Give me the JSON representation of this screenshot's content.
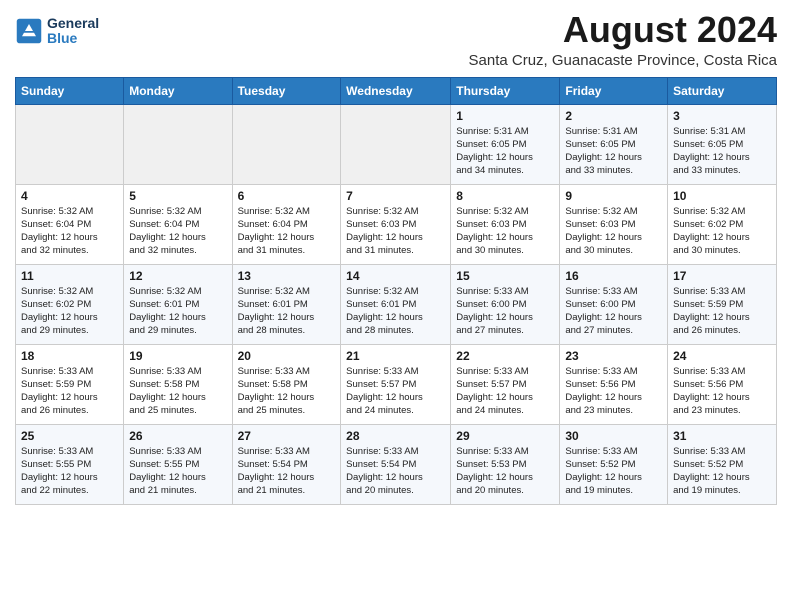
{
  "app": {
    "logo_line1": "General",
    "logo_line2": "Blue"
  },
  "header": {
    "title": "August 2024",
    "subtitle": "Santa Cruz, Guanacaste Province, Costa Rica"
  },
  "weekdays": [
    "Sunday",
    "Monday",
    "Tuesday",
    "Wednesday",
    "Thursday",
    "Friday",
    "Saturday"
  ],
  "weeks": [
    [
      {
        "day": "",
        "info": ""
      },
      {
        "day": "",
        "info": ""
      },
      {
        "day": "",
        "info": ""
      },
      {
        "day": "",
        "info": ""
      },
      {
        "day": "1",
        "info": "Sunrise: 5:31 AM\nSunset: 6:05 PM\nDaylight: 12 hours\nand 34 minutes."
      },
      {
        "day": "2",
        "info": "Sunrise: 5:31 AM\nSunset: 6:05 PM\nDaylight: 12 hours\nand 33 minutes."
      },
      {
        "day": "3",
        "info": "Sunrise: 5:31 AM\nSunset: 6:05 PM\nDaylight: 12 hours\nand 33 minutes."
      }
    ],
    [
      {
        "day": "4",
        "info": "Sunrise: 5:32 AM\nSunset: 6:04 PM\nDaylight: 12 hours\nand 32 minutes."
      },
      {
        "day": "5",
        "info": "Sunrise: 5:32 AM\nSunset: 6:04 PM\nDaylight: 12 hours\nand 32 minutes."
      },
      {
        "day": "6",
        "info": "Sunrise: 5:32 AM\nSunset: 6:04 PM\nDaylight: 12 hours\nand 31 minutes."
      },
      {
        "day": "7",
        "info": "Sunrise: 5:32 AM\nSunset: 6:03 PM\nDaylight: 12 hours\nand 31 minutes."
      },
      {
        "day": "8",
        "info": "Sunrise: 5:32 AM\nSunset: 6:03 PM\nDaylight: 12 hours\nand 30 minutes."
      },
      {
        "day": "9",
        "info": "Sunrise: 5:32 AM\nSunset: 6:03 PM\nDaylight: 12 hours\nand 30 minutes."
      },
      {
        "day": "10",
        "info": "Sunrise: 5:32 AM\nSunset: 6:02 PM\nDaylight: 12 hours\nand 30 minutes."
      }
    ],
    [
      {
        "day": "11",
        "info": "Sunrise: 5:32 AM\nSunset: 6:02 PM\nDaylight: 12 hours\nand 29 minutes."
      },
      {
        "day": "12",
        "info": "Sunrise: 5:32 AM\nSunset: 6:01 PM\nDaylight: 12 hours\nand 29 minutes."
      },
      {
        "day": "13",
        "info": "Sunrise: 5:32 AM\nSunset: 6:01 PM\nDaylight: 12 hours\nand 28 minutes."
      },
      {
        "day": "14",
        "info": "Sunrise: 5:32 AM\nSunset: 6:01 PM\nDaylight: 12 hours\nand 28 minutes."
      },
      {
        "day": "15",
        "info": "Sunrise: 5:33 AM\nSunset: 6:00 PM\nDaylight: 12 hours\nand 27 minutes."
      },
      {
        "day": "16",
        "info": "Sunrise: 5:33 AM\nSunset: 6:00 PM\nDaylight: 12 hours\nand 27 minutes."
      },
      {
        "day": "17",
        "info": "Sunrise: 5:33 AM\nSunset: 5:59 PM\nDaylight: 12 hours\nand 26 minutes."
      }
    ],
    [
      {
        "day": "18",
        "info": "Sunrise: 5:33 AM\nSunset: 5:59 PM\nDaylight: 12 hours\nand 26 minutes."
      },
      {
        "day": "19",
        "info": "Sunrise: 5:33 AM\nSunset: 5:58 PM\nDaylight: 12 hours\nand 25 minutes."
      },
      {
        "day": "20",
        "info": "Sunrise: 5:33 AM\nSunset: 5:58 PM\nDaylight: 12 hours\nand 25 minutes."
      },
      {
        "day": "21",
        "info": "Sunrise: 5:33 AM\nSunset: 5:57 PM\nDaylight: 12 hours\nand 24 minutes."
      },
      {
        "day": "22",
        "info": "Sunrise: 5:33 AM\nSunset: 5:57 PM\nDaylight: 12 hours\nand 24 minutes."
      },
      {
        "day": "23",
        "info": "Sunrise: 5:33 AM\nSunset: 5:56 PM\nDaylight: 12 hours\nand 23 minutes."
      },
      {
        "day": "24",
        "info": "Sunrise: 5:33 AM\nSunset: 5:56 PM\nDaylight: 12 hours\nand 23 minutes."
      }
    ],
    [
      {
        "day": "25",
        "info": "Sunrise: 5:33 AM\nSunset: 5:55 PM\nDaylight: 12 hours\nand 22 minutes."
      },
      {
        "day": "26",
        "info": "Sunrise: 5:33 AM\nSunset: 5:55 PM\nDaylight: 12 hours\nand 21 minutes."
      },
      {
        "day": "27",
        "info": "Sunrise: 5:33 AM\nSunset: 5:54 PM\nDaylight: 12 hours\nand 21 minutes."
      },
      {
        "day": "28",
        "info": "Sunrise: 5:33 AM\nSunset: 5:54 PM\nDaylight: 12 hours\nand 20 minutes."
      },
      {
        "day": "29",
        "info": "Sunrise: 5:33 AM\nSunset: 5:53 PM\nDaylight: 12 hours\nand 20 minutes."
      },
      {
        "day": "30",
        "info": "Sunrise: 5:33 AM\nSunset: 5:52 PM\nDaylight: 12 hours\nand 19 minutes."
      },
      {
        "day": "31",
        "info": "Sunrise: 5:33 AM\nSunset: 5:52 PM\nDaylight: 12 hours\nand 19 minutes."
      }
    ]
  ]
}
